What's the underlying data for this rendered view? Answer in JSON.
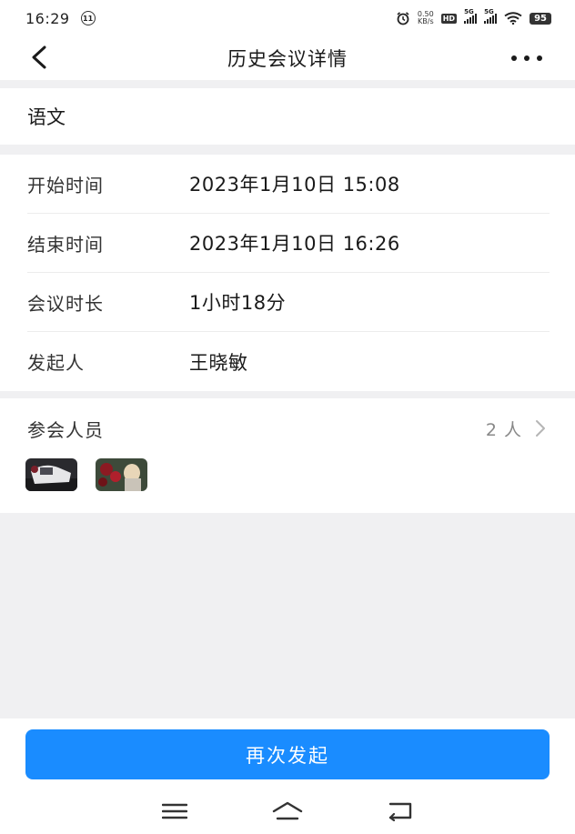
{
  "status_bar": {
    "time": "16:29",
    "notif_badge": "⑪",
    "net_speed_value": "0.50",
    "net_speed_unit": "KB/s",
    "hd_label": "HD",
    "signal1_label": "5G",
    "signal2_label": "5G",
    "battery": "95"
  },
  "header": {
    "title": "历史会议详情"
  },
  "subject": {
    "name": "语文"
  },
  "info": {
    "rows": [
      {
        "label": "开始时间",
        "value": "2023年1月10日 15:08"
      },
      {
        "label": "结束时间",
        "value": "2023年1月10日 16:26"
      },
      {
        "label": "会议时长",
        "value": "1小时18分"
      },
      {
        "label": "发起人",
        "value": "王晓敏"
      }
    ]
  },
  "participants": {
    "title": "参会人员",
    "count": "2 人"
  },
  "actions": {
    "restart_label": "再次发起"
  },
  "colors": {
    "accent": "#1a8cff",
    "page_bg": "#f0f0f2"
  }
}
